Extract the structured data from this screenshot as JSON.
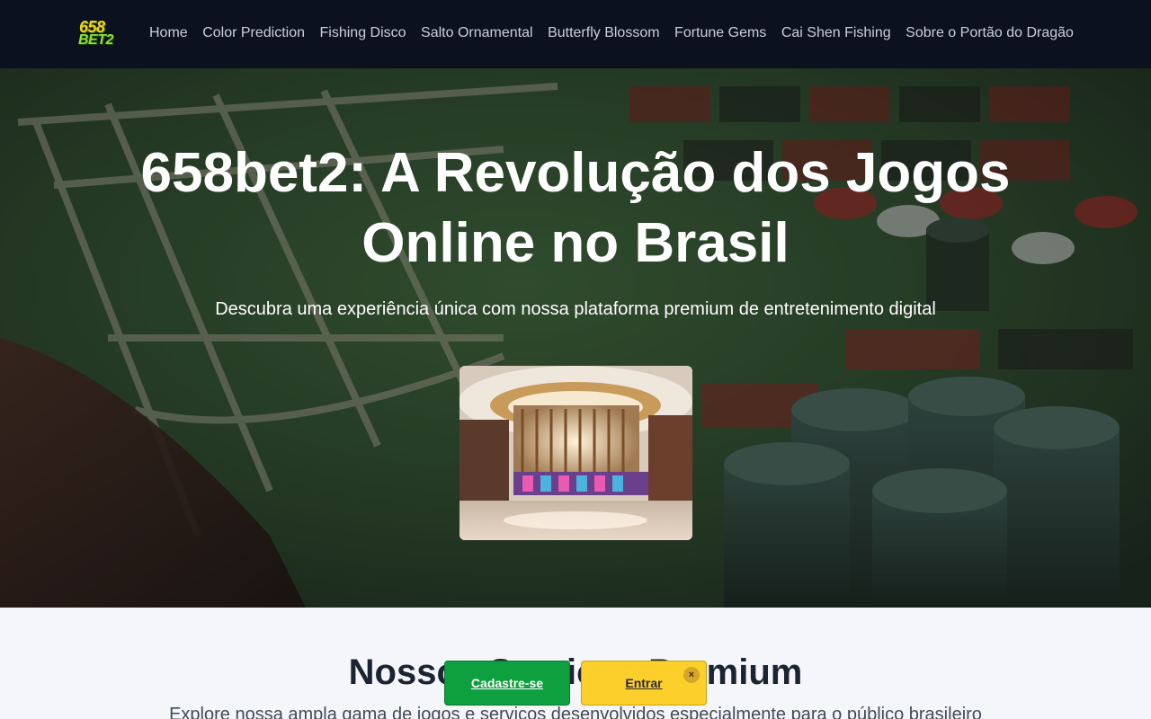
{
  "nav": {
    "logo_top": "658",
    "logo_bottom": "BET2",
    "links": [
      "Home",
      "Color Prediction",
      "Fishing Disco",
      "Salto Ornamental",
      "Butterfly Blossom",
      "Fortune Gems",
      "Cai Shen Fishing",
      "Sobre o Portão do Dragão"
    ]
  },
  "hero": {
    "title": "658bet2: A Revolução dos Jogos Online no Brasil",
    "subtitle": "Descubra uma experiência única com nossa plataforma premium de entretenimento digital"
  },
  "services": {
    "title": "Nossos Serviços Premium",
    "description": "Explore nossa ampla gama de jogos e serviços desenvolvidos especialmente para o público brasileiro"
  },
  "cta": {
    "register_label": "Cadastre-se",
    "login_label": "Entrar",
    "close_label": "×"
  },
  "colors": {
    "nav_bg": "#0c1120",
    "register": "#0e9f3f",
    "login": "#fccf2a"
  }
}
